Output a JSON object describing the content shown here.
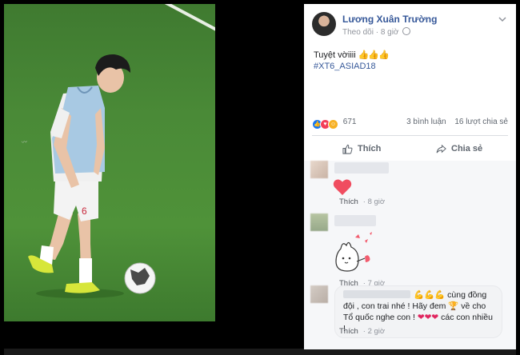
{
  "post": {
    "author": "Lương Xuân Trường",
    "follow_label": "Theo dõi",
    "time": "8 giờ",
    "text": "Tuyệt vờiiii",
    "thumbs": "👍👍👍",
    "hashtag": "#XT6_ASIAD18",
    "reaction_count": "671",
    "comments_count": "3 bình luận",
    "shares_count": "16 lượt chia sẻ"
  },
  "actions": {
    "like_label": "Thích",
    "share_label": "Chia sẻ"
  },
  "comments": [
    {
      "like_label": "Thích",
      "time": "8 giờ"
    },
    {
      "like_label": "Thích",
      "time": "7 giờ"
    },
    {
      "text_a": "💪💪💪 cùng đồng đội , con trai nhé ! Hãy đem 🏆 về cho Tổ quốc nghe con ! ",
      "hearts": "❤❤❤",
      "text_b": " các con nhiều !",
      "like_label": "Thích",
      "time": "2 giờ"
    }
  ],
  "colors": {
    "link_blue": "#365899",
    "like_blue": "#1877f2",
    "love_red": "#f33e58",
    "haha_yellow": "#f7b125",
    "grass": "#4a8a37"
  }
}
